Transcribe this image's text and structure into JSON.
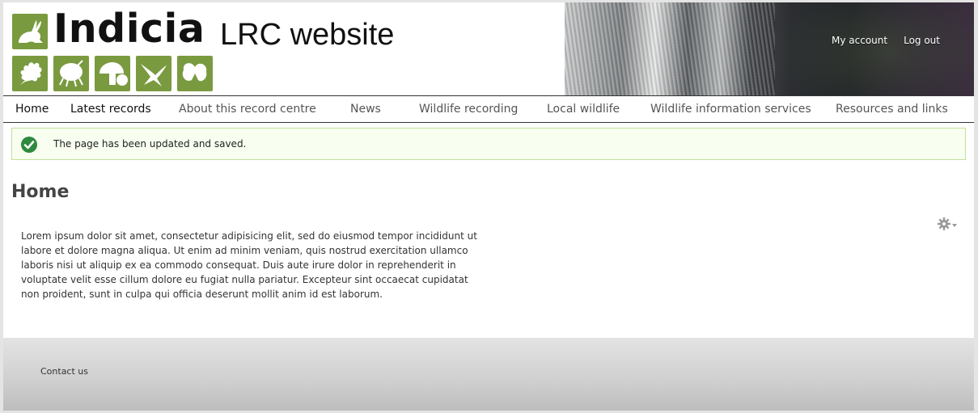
{
  "header": {
    "logo_text_bold": "Indicia",
    "logo_text_light": "LRC website",
    "logo_icons": [
      "hare-icon",
      "oak-leaf-icon",
      "beetle-icon",
      "mushroom-icon",
      "swallow-icon",
      "butterfly-icon"
    ],
    "user_links": {
      "my_account": "My account",
      "log_out": "Log out"
    }
  },
  "nav": {
    "items": [
      {
        "label": "Home",
        "active": true
      },
      {
        "label": "Latest records"
      },
      {
        "label": "About this record centre"
      },
      {
        "label": "News"
      },
      {
        "label": "Wildlife recording"
      },
      {
        "label": "Local wildlife"
      },
      {
        "label": "Wildlife information services"
      },
      {
        "label": "Resources and links"
      }
    ]
  },
  "status": {
    "message": "The page has been updated and saved.",
    "icon": "check-circle-icon"
  },
  "main": {
    "title": "Home",
    "body": "Lorem ipsum dolor sit amet, consectetur adipisicing elit, sed do eiusmod tempor incididunt ut labore et dolore magna aliqua. Ut enim ad minim veniam, quis nostrud exercitation ullamco laboris nisi ut aliquip ex ea commodo consequat. Duis aute irure dolor in reprehenderit in voluptate velit esse cillum dolore eu fugiat nulla pariatur. Excepteur sint occaecat cupidatat non proident, sunt in culpa qui officia deserunt mollit anim id est laborum.",
    "gear_icon": "gear-icon"
  },
  "footer": {
    "contact": "Contact us"
  },
  "colors": {
    "logo_green": "#7a9a3f",
    "status_bg": "#f8fff0",
    "status_border": "#bee39a",
    "status_check": "#2d8a3e"
  }
}
